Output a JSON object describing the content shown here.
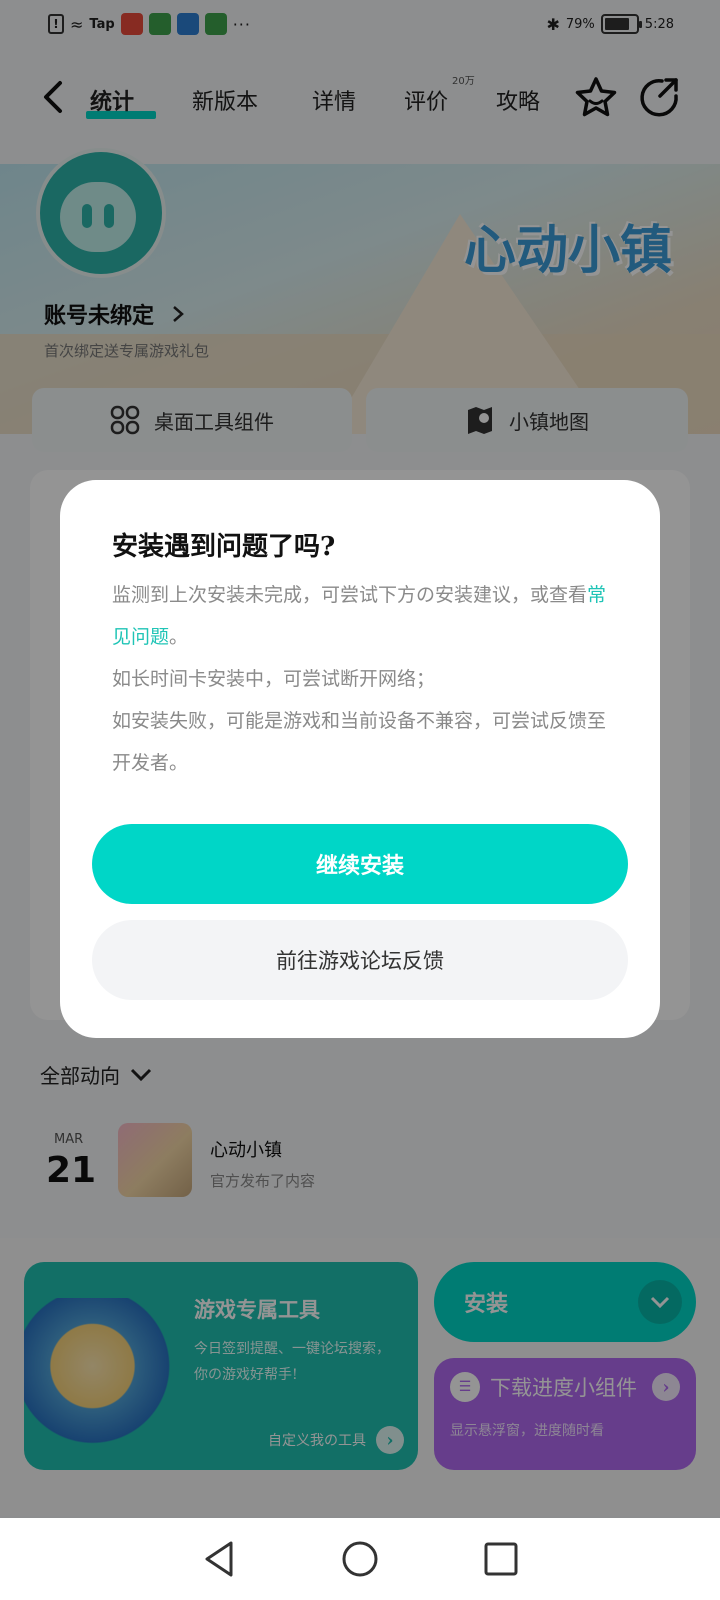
{
  "status_bar": {
    "carrier_tag": "Tap",
    "battery": "79%",
    "battery_level": 0.79,
    "time": "5:28"
  },
  "nav": {
    "tabs": [
      {
        "label": "统计"
      },
      {
        "label": "新版本"
      },
      {
        "label": "详情"
      },
      {
        "label": "评价"
      },
      {
        "label": "攻略"
      }
    ],
    "review_badge": "20万"
  },
  "banner": {
    "game_logo": "心动小镇",
    "account_title": "账号未绑定",
    "account_subtitle": "首次绑定送专属游戏礼包"
  },
  "quick_tools": {
    "desktop_widget": "桌面工具组件",
    "town_map": "小镇地图"
  },
  "dialog": {
    "title": "安装遇到问题了吗?",
    "line1_a": "监测到上次安装未完成，可尝试下方の安装建议，或查看",
    "line1_link": "常见问题",
    "line1_end": "。",
    "line2": "如长时间卡安装中，可尝试断开网络；",
    "line3": "如安装失败，可能是游戏和当前设备不兼容，可尝试反馈至开发者。",
    "primary_button": "继续安装",
    "secondary_button": "前往游戏论坛反馈"
  },
  "feed": {
    "title": "全部动向",
    "month": "MAR",
    "day": "21",
    "name": "心动小镇",
    "description": "官方发布了内容"
  },
  "tools_card": {
    "title": "游戏专属工具",
    "description": "今日签到提醒、一键论坛搜索，你の游戏好帮手!",
    "link": "自定义我の工具"
  },
  "install_button": {
    "label": "安装"
  },
  "progress_card": {
    "label": "下载进度小组件",
    "subtitle": "显示悬浮窗，进度随时看"
  },
  "colors": {
    "accent": "#00d6c7",
    "purple": "#b06af0",
    "link": "#1fc4b6"
  }
}
